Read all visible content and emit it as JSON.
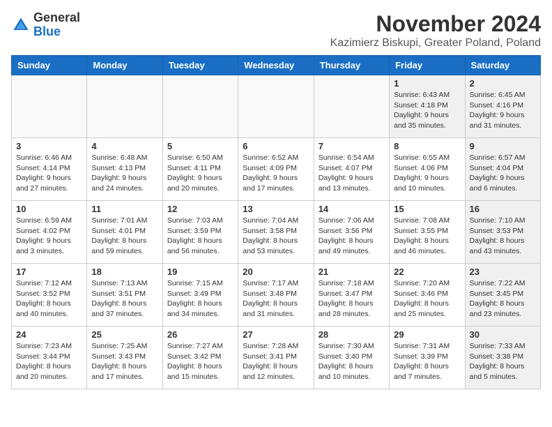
{
  "header": {
    "logo_line1": "General",
    "logo_line2": "Blue",
    "month_title": "November 2024",
    "location": "Kazimierz Biskupi, Greater Poland, Poland"
  },
  "weekdays": [
    "Sunday",
    "Monday",
    "Tuesday",
    "Wednesday",
    "Thursday",
    "Friday",
    "Saturday"
  ],
  "weeks": [
    [
      {
        "day": "",
        "info": ""
      },
      {
        "day": "",
        "info": ""
      },
      {
        "day": "",
        "info": ""
      },
      {
        "day": "",
        "info": ""
      },
      {
        "day": "",
        "info": ""
      },
      {
        "day": "1",
        "info": "Sunrise: 6:43 AM\nSunset: 4:18 PM\nDaylight: 9 hours\nand 35 minutes."
      },
      {
        "day": "2",
        "info": "Sunrise: 6:45 AM\nSunset: 4:16 PM\nDaylight: 9 hours\nand 31 minutes."
      }
    ],
    [
      {
        "day": "3",
        "info": "Sunrise: 6:46 AM\nSunset: 4:14 PM\nDaylight: 9 hours\nand 27 minutes."
      },
      {
        "day": "4",
        "info": "Sunrise: 6:48 AM\nSunset: 4:13 PM\nDaylight: 9 hours\nand 24 minutes."
      },
      {
        "day": "5",
        "info": "Sunrise: 6:50 AM\nSunset: 4:11 PM\nDaylight: 9 hours\nand 20 minutes."
      },
      {
        "day": "6",
        "info": "Sunrise: 6:52 AM\nSunset: 4:09 PM\nDaylight: 9 hours\nand 17 minutes."
      },
      {
        "day": "7",
        "info": "Sunrise: 6:54 AM\nSunset: 4:07 PM\nDaylight: 9 hours\nand 13 minutes."
      },
      {
        "day": "8",
        "info": "Sunrise: 6:55 AM\nSunset: 4:06 PM\nDaylight: 9 hours\nand 10 minutes."
      },
      {
        "day": "9",
        "info": "Sunrise: 6:57 AM\nSunset: 4:04 PM\nDaylight: 9 hours\nand 6 minutes."
      }
    ],
    [
      {
        "day": "10",
        "info": "Sunrise: 6:59 AM\nSunset: 4:02 PM\nDaylight: 9 hours\nand 3 minutes."
      },
      {
        "day": "11",
        "info": "Sunrise: 7:01 AM\nSunset: 4:01 PM\nDaylight: 8 hours\nand 59 minutes."
      },
      {
        "day": "12",
        "info": "Sunrise: 7:03 AM\nSunset: 3:59 PM\nDaylight: 8 hours\nand 56 minutes."
      },
      {
        "day": "13",
        "info": "Sunrise: 7:04 AM\nSunset: 3:58 PM\nDaylight: 8 hours\nand 53 minutes."
      },
      {
        "day": "14",
        "info": "Sunrise: 7:06 AM\nSunset: 3:56 PM\nDaylight: 8 hours\nand 49 minutes."
      },
      {
        "day": "15",
        "info": "Sunrise: 7:08 AM\nSunset: 3:55 PM\nDaylight: 8 hours\nand 46 minutes."
      },
      {
        "day": "16",
        "info": "Sunrise: 7:10 AM\nSunset: 3:53 PM\nDaylight: 8 hours\nand 43 minutes."
      }
    ],
    [
      {
        "day": "17",
        "info": "Sunrise: 7:12 AM\nSunset: 3:52 PM\nDaylight: 8 hours\nand 40 minutes."
      },
      {
        "day": "18",
        "info": "Sunrise: 7:13 AM\nSunset: 3:51 PM\nDaylight: 8 hours\nand 37 minutes."
      },
      {
        "day": "19",
        "info": "Sunrise: 7:15 AM\nSunset: 3:49 PM\nDaylight: 8 hours\nand 34 minutes."
      },
      {
        "day": "20",
        "info": "Sunrise: 7:17 AM\nSunset: 3:48 PM\nDaylight: 8 hours\nand 31 minutes."
      },
      {
        "day": "21",
        "info": "Sunrise: 7:18 AM\nSunset: 3:47 PM\nDaylight: 8 hours\nand 28 minutes."
      },
      {
        "day": "22",
        "info": "Sunrise: 7:20 AM\nSunset: 3:46 PM\nDaylight: 8 hours\nand 25 minutes."
      },
      {
        "day": "23",
        "info": "Sunrise: 7:22 AM\nSunset: 3:45 PM\nDaylight: 8 hours\nand 23 minutes."
      }
    ],
    [
      {
        "day": "24",
        "info": "Sunrise: 7:23 AM\nSunset: 3:44 PM\nDaylight: 8 hours\nand 20 minutes."
      },
      {
        "day": "25",
        "info": "Sunrise: 7:25 AM\nSunset: 3:43 PM\nDaylight: 8 hours\nand 17 minutes."
      },
      {
        "day": "26",
        "info": "Sunrise: 7:27 AM\nSunset: 3:42 PM\nDaylight: 8 hours\nand 15 minutes."
      },
      {
        "day": "27",
        "info": "Sunrise: 7:28 AM\nSunset: 3:41 PM\nDaylight: 8 hours\nand 12 minutes."
      },
      {
        "day": "28",
        "info": "Sunrise: 7:30 AM\nSunset: 3:40 PM\nDaylight: 8 hours\nand 10 minutes."
      },
      {
        "day": "29",
        "info": "Sunrise: 7:31 AM\nSunset: 3:39 PM\nDaylight: 8 hours\nand 7 minutes."
      },
      {
        "day": "30",
        "info": "Sunrise: 7:33 AM\nSunset: 3:38 PM\nDaylight: 8 hours\nand 5 minutes."
      }
    ]
  ]
}
